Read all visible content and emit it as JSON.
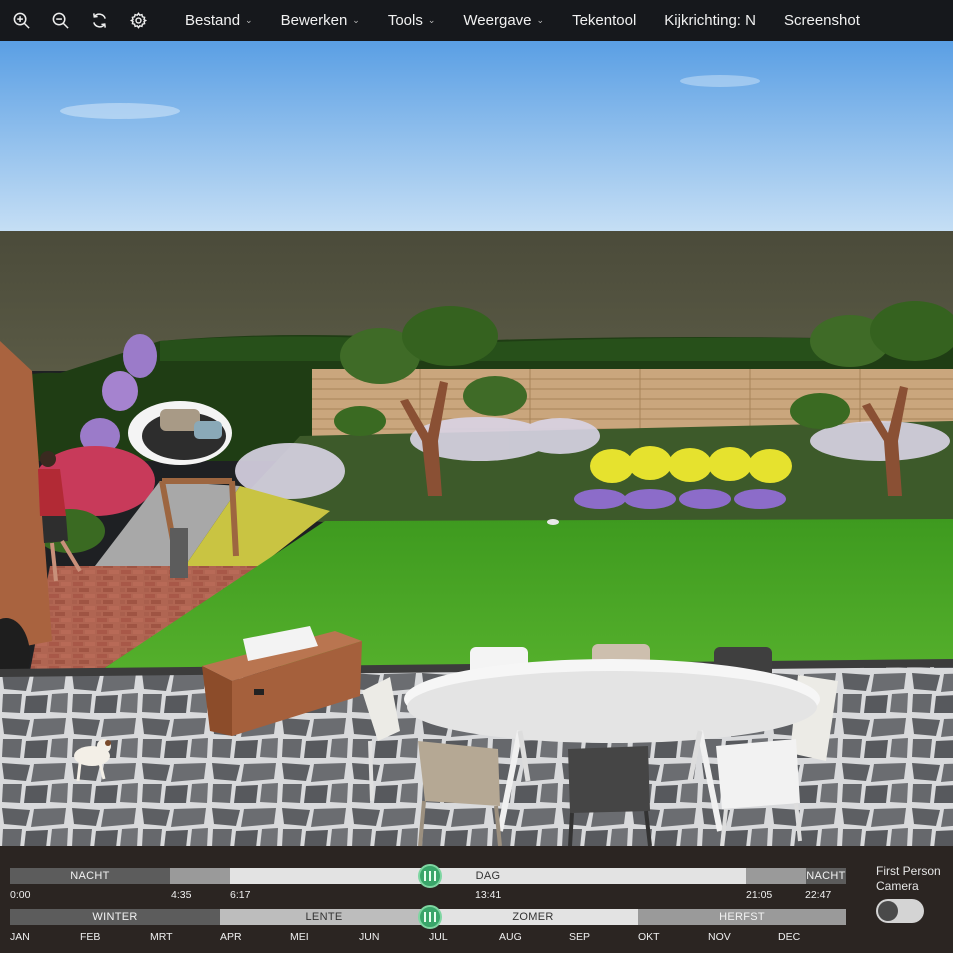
{
  "toolbar": {
    "menus": [
      {
        "label": "Bestand",
        "chevron": "⌄"
      },
      {
        "label": "Bewerken",
        "chevron": "⌄"
      },
      {
        "label": "Tools",
        "chevron": "⌄"
      },
      {
        "label": "Weergave",
        "chevron": "⌄"
      },
      {
        "label": "Tekentool",
        "chevron": ""
      },
      {
        "label": "Kijkrichting: N",
        "chevron": ""
      },
      {
        "label": "Screenshot",
        "chevron": ""
      }
    ],
    "icons": [
      "zoom-in-icon",
      "zoom-out-icon",
      "refresh-icon",
      "gear-icon"
    ]
  },
  "timeline": {
    "day": {
      "segments": [
        "NACHT",
        "DAG",
        "NACHT"
      ],
      "ticks": [
        "0:00",
        "4:35",
        "6:17",
        "13:41",
        "21:05",
        "22:47"
      ],
      "current": "13:41"
    },
    "season": {
      "segments": [
        "WINTER",
        "LENTE",
        "ZOMER",
        "HERFST"
      ],
      "months": [
        "JAN",
        "FEB",
        "MRT",
        "APR",
        "MEI",
        "JUN",
        "JUL",
        "AUG",
        "SEP",
        "OKT",
        "NOV",
        "DEC"
      ],
      "current": "JUL"
    }
  },
  "camera": {
    "label_line1": "First Person",
    "label_line2": "Camera",
    "enabled": false
  },
  "colors": {
    "toolbar_bg": "#16181c",
    "slider_handle": "#3aa66a",
    "lawn": "#4aa226",
    "sky": "#7cb5ea"
  }
}
